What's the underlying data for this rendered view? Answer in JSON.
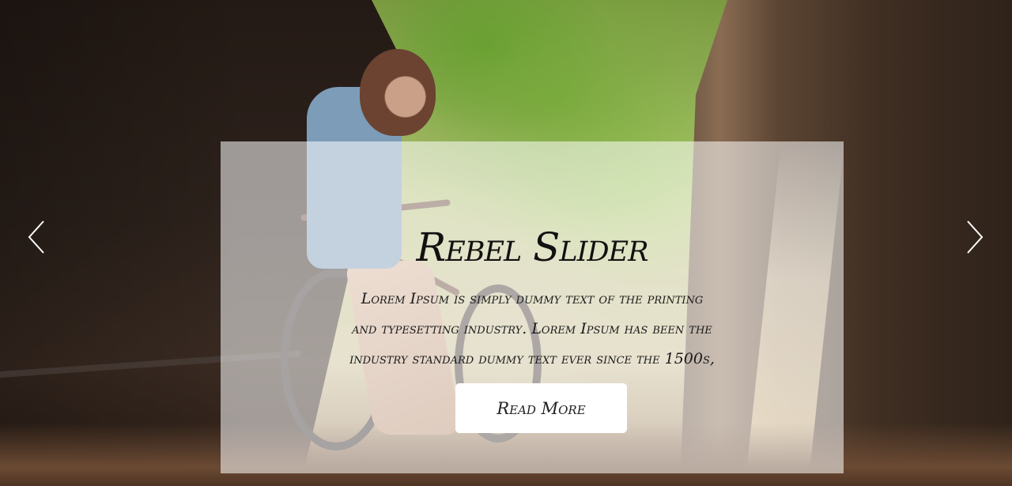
{
  "slider": {
    "title": "Rebel Slider",
    "description": "Lorem Ipsum is simply dummy text of the printing and typesetting industry. Lorem Ipsum has been the industry standard dummy text ever since the 1500s,",
    "read_more_label": "Read More",
    "prev_icon": "chevron-left-icon",
    "next_icon": "chevron-right-icon",
    "panel_color": "#ffffff",
    "text_color": "#111111"
  }
}
